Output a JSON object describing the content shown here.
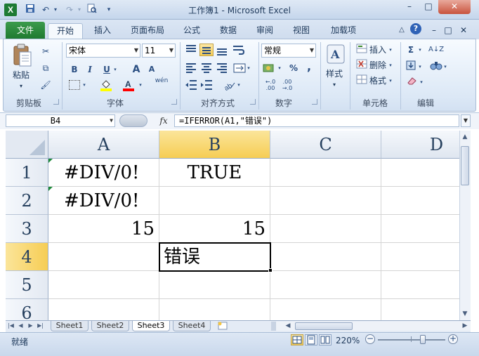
{
  "window": {
    "title": "工作簿1 - Microsoft Excel",
    "app_icon": "X",
    "minimize": "–",
    "maximize": "□",
    "close": "✕"
  },
  "qat": {
    "save_icon": "▪",
    "undo_icon": "↶",
    "redo_icon": "↷",
    "print_preview_icon": "🔍",
    "customize_icon": "▾"
  },
  "ribbon_tabs": {
    "file": "文件",
    "items": [
      "开始",
      "插入",
      "页面布局",
      "公式",
      "数据",
      "审阅",
      "视图",
      "加载项"
    ],
    "active": "开始",
    "right_icons": [
      "△",
      "?",
      "–",
      "□",
      "✕"
    ]
  },
  "ribbon": {
    "clipboard": {
      "label": "剪贴板",
      "paste": "粘贴",
      "cut_icon": "✂",
      "copy_icon": "⧉",
      "format_painter_icon": "🖌"
    },
    "font": {
      "label": "字体",
      "font_name": "宋体",
      "font_size": "11",
      "bold": "B",
      "italic": "I",
      "underline": "U",
      "grow": "A",
      "shrink": "A",
      "wen": "wén",
      "fill_color": "#ffff00",
      "font_color": "#ff0000"
    },
    "alignment": {
      "label": "对齐方式"
    },
    "number": {
      "label": "数字",
      "format": "常规",
      "percent": "%",
      "comma": ","
    },
    "styles": {
      "label": "样式"
    },
    "cells": {
      "label": "单元格",
      "insert": "插入",
      "delete": "删除",
      "format": "格式"
    },
    "editing": {
      "label": "编辑"
    }
  },
  "formula_bar": {
    "name_box": "B4",
    "fx": "fx",
    "formula": "=IFERROR(A1,\"错误\")"
  },
  "grid": {
    "columns": [
      "A",
      "B",
      "C",
      "D"
    ],
    "selected_column": "B",
    "rows": [
      "1",
      "2",
      "3",
      "4",
      "5",
      "6"
    ],
    "selected_row": "4",
    "cells": {
      "A1": "#DIV/0!",
      "B1": "TRUE",
      "A2": "#DIV/0!",
      "A3": "15",
      "B3": "15",
      "B4": "错误"
    },
    "active_cell": "B4"
  },
  "sheet_tabs": [
    "Sheet1",
    "Sheet2",
    "Sheet3",
    "Sheet4"
  ],
  "active_sheet": "Sheet3",
  "status_bar": {
    "ready": "就绪",
    "zoom": "220%",
    "zoom_minus": "−",
    "zoom_plus": "+"
  }
}
